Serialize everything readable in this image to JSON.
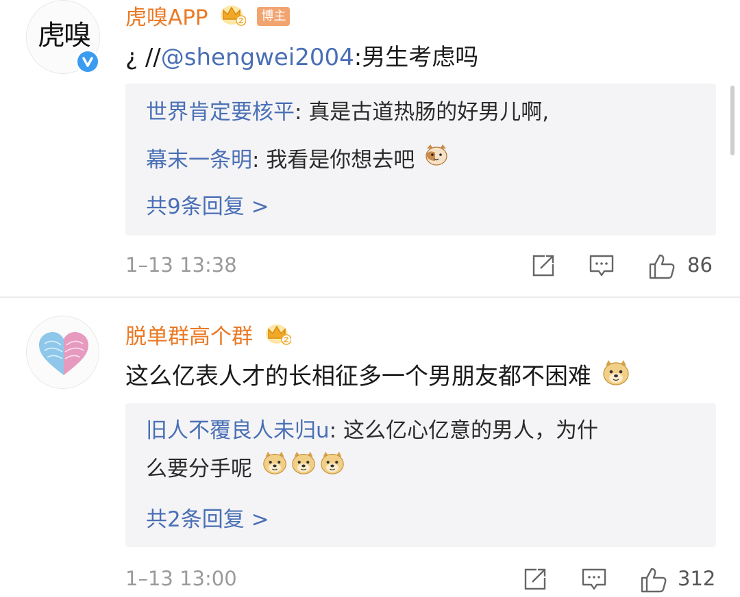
{
  "comments": [
    {
      "author": "虎嗅APP",
      "badge": "博主",
      "avatar_text": "虎嗅",
      "text_prefix": "¿ //",
      "mention": "@shengwei2004",
      "text_suffix": ":男生考虑吗",
      "replies": [
        {
          "name": "世界肯定要核平",
          "text": ": 真是古道热肠的好男儿啊,"
        },
        {
          "name": "幕末一条明",
          "text": ": 我看是你想去吧"
        }
      ],
      "more_replies": "共9条回复 >",
      "time": "1–13 13:38",
      "likes": "86"
    },
    {
      "author": "脱单群高个群",
      "text": "这么亿表人才的长相征多一个男朋友都不困难",
      "replies": [
        {
          "name": "旧人不覆良人未归u",
          "text": ": 这么亿心亿意的男人，为什",
          "text_line2": "么要分手呢"
        }
      ],
      "more_replies": "共2条回复 >",
      "time": "1–13 13:00",
      "likes": "312"
    }
  ],
  "icons": [
    "crown-icon",
    "verified-icon",
    "repost-icon",
    "comment-icon",
    "like-icon",
    "cat-emoji-icon",
    "doge-emoji-icon"
  ],
  "colors": {
    "author": "#ea7a26",
    "link": "#4a6fb5",
    "reply_bg": "#f4f4f6",
    "meta": "#9a9a9a",
    "verified": "#3b9bf0"
  }
}
